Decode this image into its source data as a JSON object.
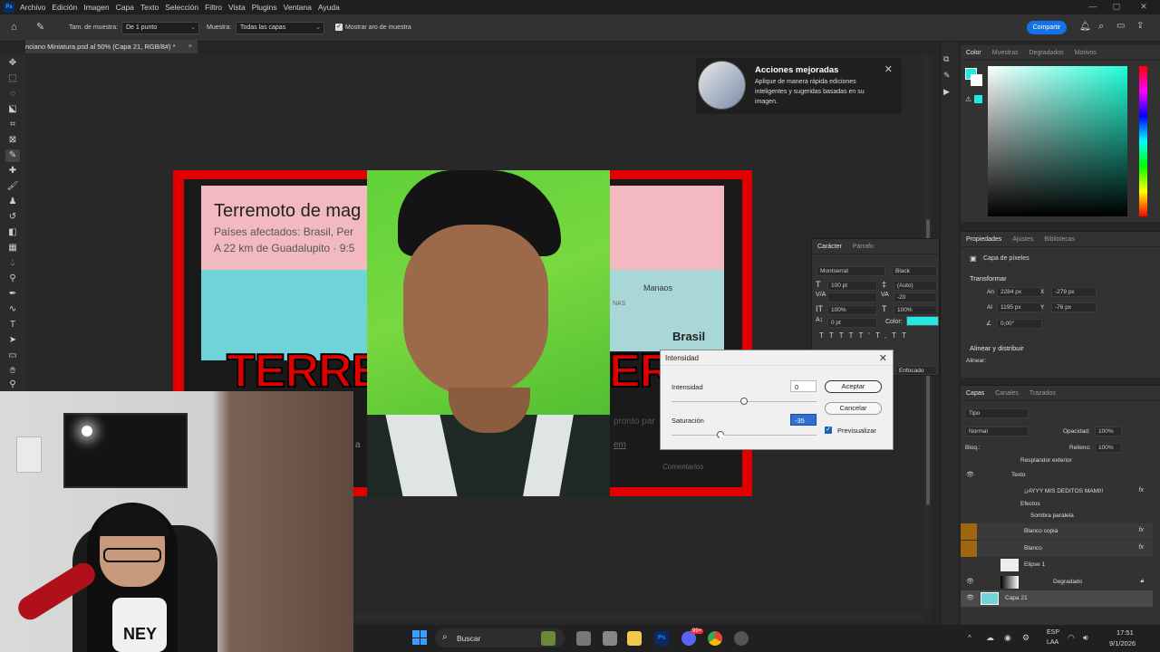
{
  "menu": {
    "logo": "Ps",
    "items": [
      "Archivo",
      "Edición",
      "Imagen",
      "Capa",
      "Texto",
      "Selección",
      "Filtro",
      "Vista",
      "Plugins",
      "Ventana",
      "Ayuda"
    ]
  },
  "options": {
    "sample_size_label": "Tam. de muestra:",
    "sample_size_value": "De 1 punto",
    "sample_label": "Muestra:",
    "sample_value": "Todas las capas",
    "show_ring_label": "Mostrar aro de muestra",
    "share_label": "Compartir"
  },
  "document": {
    "tab_title": "nciano Miniatura.psd al 50% (Capa 21, RGB/8#) *"
  },
  "artwork": {
    "headline": "Terremoto de mag",
    "line2": "Países afectados: Brasil, Per",
    "line3": "A 22 km de Guadalupito · 9:5",
    "big_left": "TERRE",
    "big_right": "ER",
    "manaos": "Manaos",
    "brasil": "Brasil",
    "pronto": "pronto par",
    "comentarios": "Comentarios",
    "lnas": "NAS",
    "link": "em",
    "side_letter": "a"
  },
  "notification": {
    "title": "Acciones mejoradas",
    "body": "Aplique de manera rápida ediciones inteligentes y sugeridas basadas en su imagen."
  },
  "character_panel": {
    "tabs": [
      "Carácter",
      "Párrafo"
    ],
    "font": "Montserrat",
    "style": "Black",
    "size": "100 pt",
    "leading": "(Auto)",
    "tracking": "-20",
    "vscale": "100%",
    "hscale": "100%",
    "baseline": "0 pt",
    "color_label": "Color:",
    "color": "#22e8e2",
    "antialias": "Enfocado"
  },
  "dialog": {
    "title": "Intensidad",
    "intensity_label": "Intensidad",
    "intensity_value": "0",
    "saturation_label": "Saturación",
    "saturation_value": "-35",
    "accept": "Aceptar",
    "cancel": "Cancelar",
    "preview": "Previsualizar"
  },
  "color_panel": {
    "tabs": [
      "Color",
      "Muestras",
      "Degradados",
      "Motivos"
    ]
  },
  "properties_panel": {
    "tabs": [
      "Propiedades",
      "Ajustes",
      "Bibliotecas"
    ],
    "kind": "Capa de píxeles",
    "transform": "Transformar",
    "w_label": "An",
    "w": "2284 px",
    "x_label": "X",
    "x": "-279 px",
    "h_label": "Al",
    "h": "1195 px",
    "y_label": "Y",
    "y": "-76 px",
    "angle": "0,00°",
    "align": "Alinear y distribuir",
    "align_sub": "Alinear:"
  },
  "layers_panel": {
    "tabs": [
      "Capas",
      "Canales",
      "Trazados"
    ],
    "search_placeholder": "Tipo",
    "blend": "Normal",
    "opacity_label": "Opacidad:",
    "opacity": "100%",
    "lock_label": "Bloq.:",
    "fill_label": "Relleno:",
    "fill": "100%",
    "layers": [
      {
        "name": "Resplandor exterior",
        "indent": 2
      },
      {
        "name": "Texto",
        "indent": 1
      },
      {
        "name": "¡¡AYYY MIS DEDITOS MAMI!!",
        "indent": 2
      },
      {
        "name": "Efectos",
        "indent": 3
      },
      {
        "name": "Sombra paralela",
        "indent": 4
      },
      {
        "name": "Blanco copia",
        "indent": 2
      },
      {
        "name": "Blanco",
        "indent": 2
      },
      {
        "name": "Elipse 1",
        "indent": 1
      },
      {
        "name": "Degradado",
        "indent": 1
      },
      {
        "name": "Capa 21",
        "indent": 1
      }
    ]
  },
  "taskbar": {
    "search": "Buscar",
    "lang1": "ESP",
    "lang2": "LAA",
    "time": "17:51",
    "date": "9/1/2026",
    "badge": "99+"
  },
  "webcam": {
    "shirt_text": "NEY"
  }
}
